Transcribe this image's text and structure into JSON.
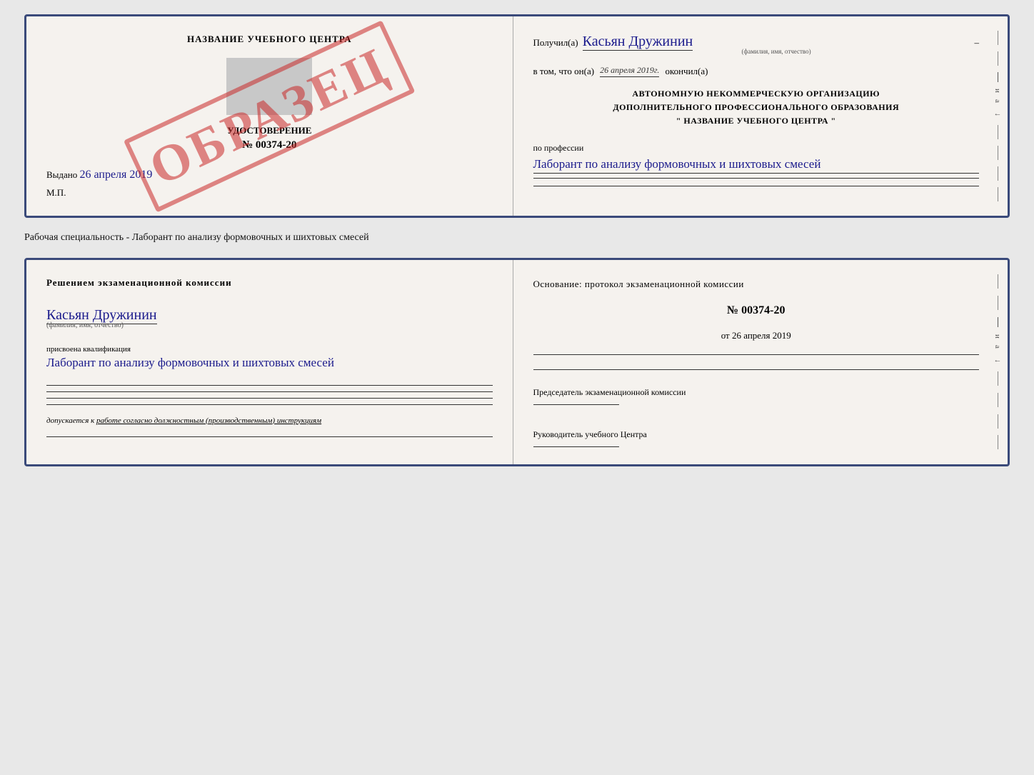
{
  "page": {
    "background": "#e8e8e8"
  },
  "top_doc": {
    "left": {
      "title": "НАЗВАНИЕ УЧЕБНОГО ЦЕНТРА",
      "cert_label": "УДОСТОВЕРЕНИЕ",
      "cert_number": "№ 00374-20",
      "issued_label": "Выдано",
      "issued_date": "26 апреля 2019",
      "mp_label": "М.П.",
      "watermark": "ОБРАЗЕЦ"
    },
    "right": {
      "received_label": "Получил(а)",
      "received_name": "Касьян Дружинин",
      "fio_caption": "(фамилия, имя, отчество)",
      "dash": "–",
      "date_label": "в том, что он(а)",
      "date_value": "26 апреля 2019г.",
      "finished_label": "окончил(а)",
      "org_line1": "АВТОНОМНУЮ НЕКОММЕРЧЕСКУЮ ОРГАНИЗАЦИЮ",
      "org_line2": "ДОПОЛНИТЕЛЬНОГО ПРОФЕССИОНАЛЬНОГО ОБРАЗОВАНИЯ",
      "org_line3": "\"  НАЗВАНИЕ УЧЕБНОГО ЦЕНТРА  \"",
      "profession_label": "по профессии",
      "profession_value": "Лаборант по анализу формовочных и шихтовых смесей"
    }
  },
  "specialty_text": "Рабочая специальность - Лаборант по анализу формовочных и шихтовых смесей",
  "bottom_doc": {
    "left": {
      "commission_title": "Решением экзаменационной комиссии",
      "name_value": "Касьян Дружинин",
      "name_caption": "(фамилия, имя, отчество)",
      "qualification_label": "присвоена квалификация",
      "qualification_value": "Лаборант по анализу формовочных и шихтовых смесей",
      "допуск_label": "допускается к",
      "допуск_value": "работе согласно должностным (производственным) инструкциям"
    },
    "right": {
      "basis_label": "Основание: протокол экзаменационной комиссии",
      "protocol_number": "№ 00374-20",
      "date_prefix": "от",
      "date_value": "26 апреля 2019",
      "chairman_label": "Председатель экзаменационной комиссии",
      "head_label": "Руководитель учебного Центра"
    }
  }
}
